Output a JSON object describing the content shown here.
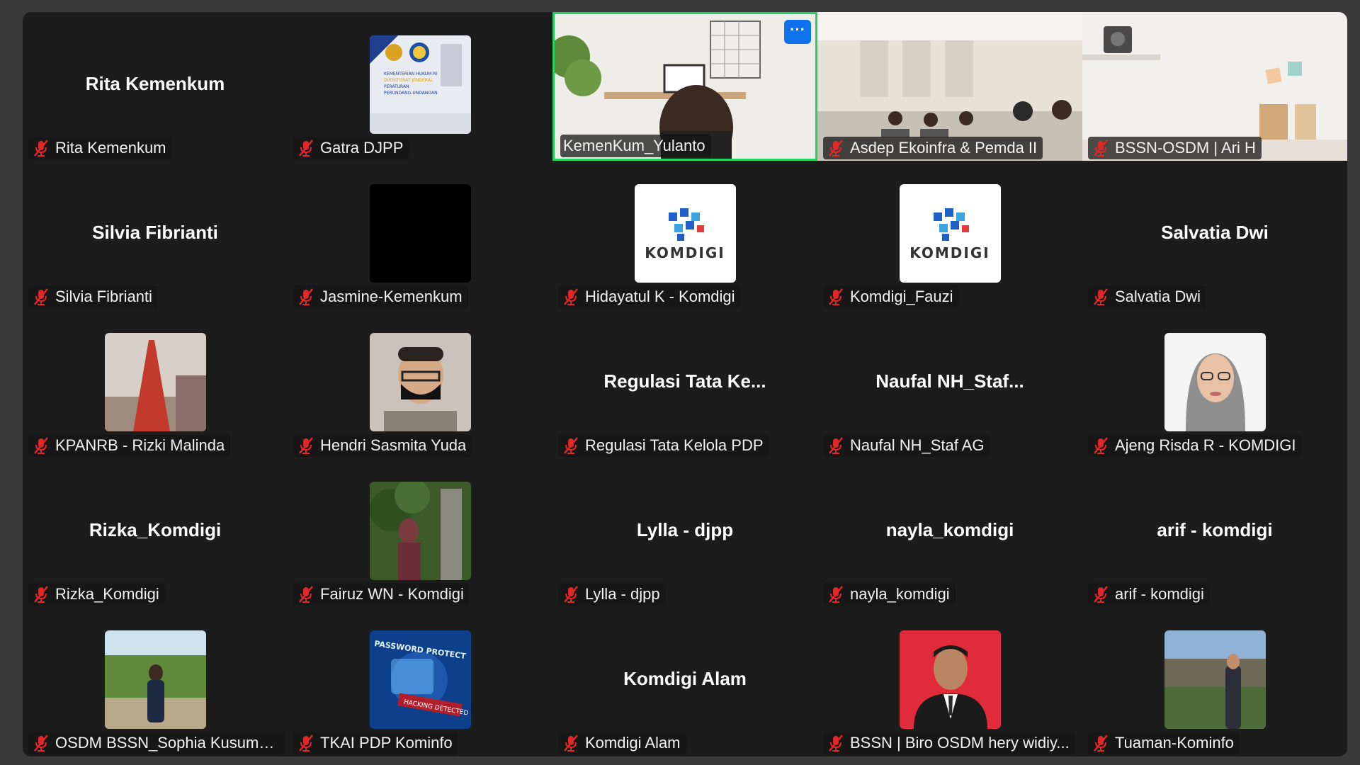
{
  "participants": [
    {
      "name": "Rita Kemenkum",
      "display": "Rita Kemenkum",
      "type": "name"
    },
    {
      "name": "Gatra DJPP",
      "type": "avatar",
      "icon": "djpp-logo-icon"
    },
    {
      "name": "KemenKum_Yulanto",
      "type": "video",
      "active": true
    },
    {
      "name": "Asdep Ekoinfra & Pemda II",
      "type": "video"
    },
    {
      "name": "BSSN-OSDM | Ari H",
      "type": "video"
    },
    {
      "name": "Silvia Fibrianti",
      "display": "Silvia Fibrianti",
      "type": "name"
    },
    {
      "name": "Jasmine-Kemenkum",
      "type": "avatar",
      "icon": "black-avatar-icon"
    },
    {
      "name": "Hidayatul K - Komdigi",
      "type": "avatar",
      "icon": "komdigi-logo-icon"
    },
    {
      "name": "Komdigi_Fauzi",
      "type": "avatar",
      "icon": "komdigi-logo-icon"
    },
    {
      "name": "Salvatia Dwi",
      "display": "Salvatia Dwi",
      "type": "name"
    },
    {
      "name": "KPANRB - Rizki Malinda",
      "type": "avatar",
      "icon": "tower-photo-icon"
    },
    {
      "name": "Hendri Sasmita Yuda",
      "type": "avatar",
      "icon": "person-mask-photo-icon"
    },
    {
      "name": "Regulasi Tata Kelola PDP",
      "display": "Regulasi Tata Ke...",
      "type": "name"
    },
    {
      "name": "Naufal NH_Staf AG",
      "display": "Naufal  NH_Staf...",
      "type": "name"
    },
    {
      "name": "Ajeng Risda R - KOMDIGI",
      "type": "avatar",
      "icon": "hijab-photo-icon"
    },
    {
      "name": "Rizka_Komdigi",
      "display": "Rizka_Komdigi",
      "type": "name"
    },
    {
      "name": "Fairuz WN - Komdigi",
      "type": "avatar",
      "icon": "garden-photo-icon"
    },
    {
      "name": "Lylla - djpp",
      "display": "Lylla - djpp",
      "type": "name"
    },
    {
      "name": "nayla_komdigi",
      "display": "nayla_komdigi",
      "type": "name"
    },
    {
      "name": "arif - komdigi",
      "display": "arif - komdigi",
      "type": "name"
    },
    {
      "name": "OSDM BSSN_Sophia Kusuma...",
      "type": "avatar",
      "icon": "outdoor-photo-icon"
    },
    {
      "name": "TKAI PDP Kominfo",
      "type": "avatar",
      "icon": "password-protect-icon"
    },
    {
      "name": "Komdigi Alam",
      "display": "Komdigi Alam",
      "type": "name"
    },
    {
      "name": "BSSN | Biro OSDM hery widiy...",
      "type": "avatar",
      "icon": "formal-portrait-icon"
    },
    {
      "name": "Tuaman-Kominfo",
      "type": "avatar",
      "icon": "city-photo-icon"
    }
  ],
  "colors": {
    "active_border": "#23d160",
    "muted_mic": "#e02828",
    "tile_bg": "#1c1c1c",
    "more_button": "#0e72ed"
  },
  "avatar_text": {
    "komdigi": "KOMDIGI",
    "password": "PASSWORD PROTECT",
    "hacking": "HACKING DETECTED",
    "djpp_lines": [
      "KEMENTERIAN HUKUM RI",
      "DIREKTORAT JENDERAL",
      "PERATURAN",
      "PERUNDANG-UNDANGAN"
    ]
  },
  "more_label": "···"
}
